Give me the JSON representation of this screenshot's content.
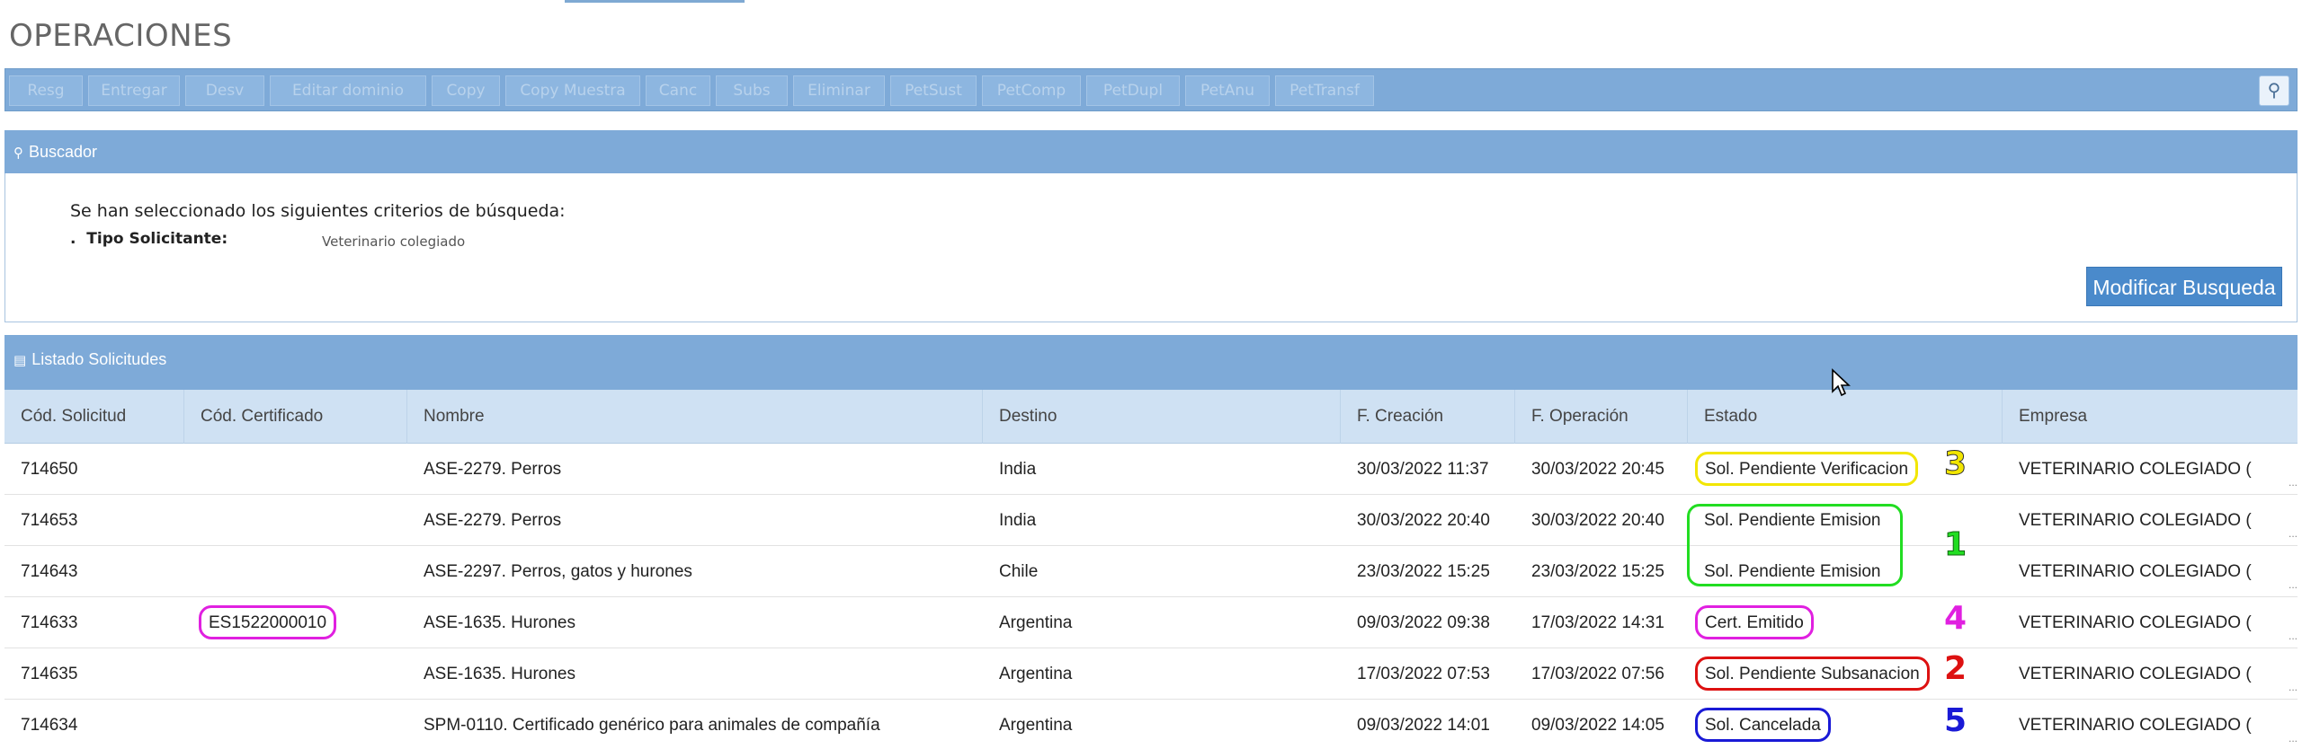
{
  "page": {
    "title": "OPERACIONES"
  },
  "toolbar": {
    "buttons": [
      "Resg",
      "Entregar",
      "Desv",
      "Editar dominio",
      "Copy",
      "Copy Muestra",
      "Canc",
      "Subs",
      "Eliminar",
      "PetSust",
      "PetComp",
      "PetDupl",
      "PetAnu",
      "PetTransf"
    ]
  },
  "buscador": {
    "title": "Buscador",
    "criteria_title": "Se han seleccionado los siguientes criterios de búsqueda:",
    "criteria_label": "Tipo Solicitante:",
    "criteria_value": "Veterinario colegiado",
    "modify_button": "Modificar Busqueda"
  },
  "listado": {
    "title": "Listado Solicitudes",
    "columns": [
      "Cód. Solicitud",
      "Cód. Certificado",
      "Nombre",
      "Destino",
      "F. Creación",
      "F. Operación",
      "Estado",
      "Empresa"
    ],
    "rows": [
      {
        "solicitud": "714650",
        "certificado": "",
        "nombre": "ASE-2279. Perros",
        "destino": "India",
        "creacion": "30/03/2022 11:37",
        "operacion": "30/03/2022 20:45",
        "estado": "Sol. Pendiente Verificacion",
        "empresa": "VETERINARIO COLEGIADO ("
      },
      {
        "solicitud": "714653",
        "certificado": "",
        "nombre": "ASE-2279. Perros",
        "destino": "India",
        "creacion": "30/03/2022 20:40",
        "operacion": "30/03/2022 20:40",
        "estado": "Sol. Pendiente Emision",
        "empresa": "VETERINARIO COLEGIADO ("
      },
      {
        "solicitud": "714643",
        "certificado": "",
        "nombre": "ASE-2297. Perros, gatos y hurones",
        "destino": "Chile",
        "creacion": "23/03/2022 15:25",
        "operacion": "23/03/2022 15:25",
        "estado": "Sol. Pendiente Emision",
        "empresa": "VETERINARIO COLEGIADO ("
      },
      {
        "solicitud": "714633",
        "certificado": "ES1522000010",
        "nombre": "ASE-1635. Hurones",
        "destino": "Argentina",
        "creacion": "09/03/2022 09:38",
        "operacion": "17/03/2022 14:31",
        "estado": "Cert. Emitido",
        "empresa": "VETERINARIO COLEGIADO ("
      },
      {
        "solicitud": "714635",
        "certificado": "",
        "nombre": "ASE-1635. Hurones",
        "destino": "Argentina",
        "creacion": "17/03/2022 07:53",
        "operacion": "17/03/2022 07:56",
        "estado": "Sol. Pendiente Subsanacion",
        "empresa": "VETERINARIO COLEGIADO ("
      },
      {
        "solicitud": "714634",
        "certificado": "",
        "nombre": "SPM-0110. Certificado genérico para animales de compañía",
        "destino": "Argentina",
        "creacion": "09/03/2022 14:01",
        "operacion": "09/03/2022 14:05",
        "estado": "Sol. Cancelada",
        "empresa": "VETERINARIO COLEGIADO ("
      }
    ]
  },
  "annotations": {
    "marks": [
      "3",
      "1",
      "4",
      "2",
      "5"
    ],
    "colors": {
      "yellow": "#f2e600",
      "green": "#22dd22",
      "magenta": "#e020e0",
      "red": "#dd1111",
      "blue": "#1a1ad6"
    }
  },
  "icons": {
    "search": "search-icon",
    "list": "list-icon",
    "cursor": "mouse-cursor-icon"
  }
}
